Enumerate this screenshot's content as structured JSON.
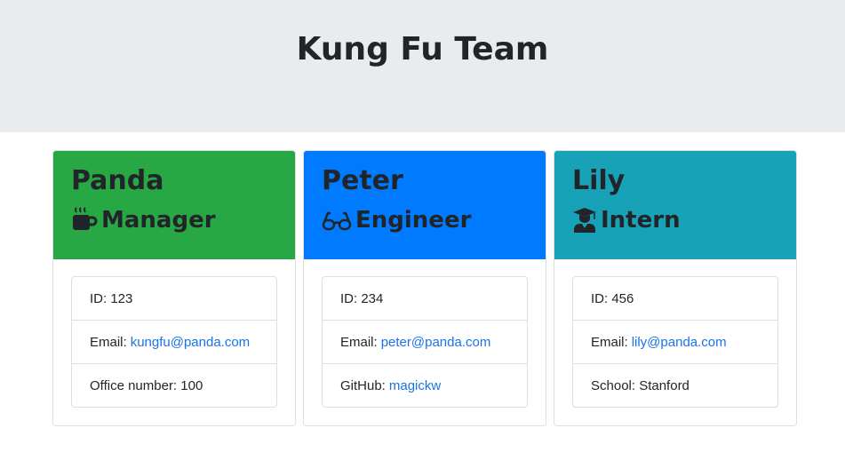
{
  "page": {
    "title": "Kung Fu Team"
  },
  "colors": {
    "manager": "#28a745",
    "engineer": "#007bff",
    "intern": "#17a2b8",
    "link": "#1a73e8"
  },
  "cards": [
    {
      "name": "Panda",
      "role": "Manager",
      "icon": "mug-icon",
      "id_label": "ID: 123",
      "email_label": "Email:",
      "email": "kungfu@panda.com",
      "extra_label": "Office number: 100"
    },
    {
      "name": "Peter",
      "role": "Engineer",
      "icon": "glasses-icon",
      "id_label": "ID: 234",
      "email_label": "Email:",
      "email": "peter@panda.com",
      "extra_label": "GitHub:",
      "extra_link": "magickw"
    },
    {
      "name": "Lily",
      "role": "Intern",
      "icon": "graduate-icon",
      "id_label": "ID: 456",
      "email_label": "Email:",
      "email": "lily@panda.com",
      "extra_label": "School: Stanford"
    }
  ]
}
